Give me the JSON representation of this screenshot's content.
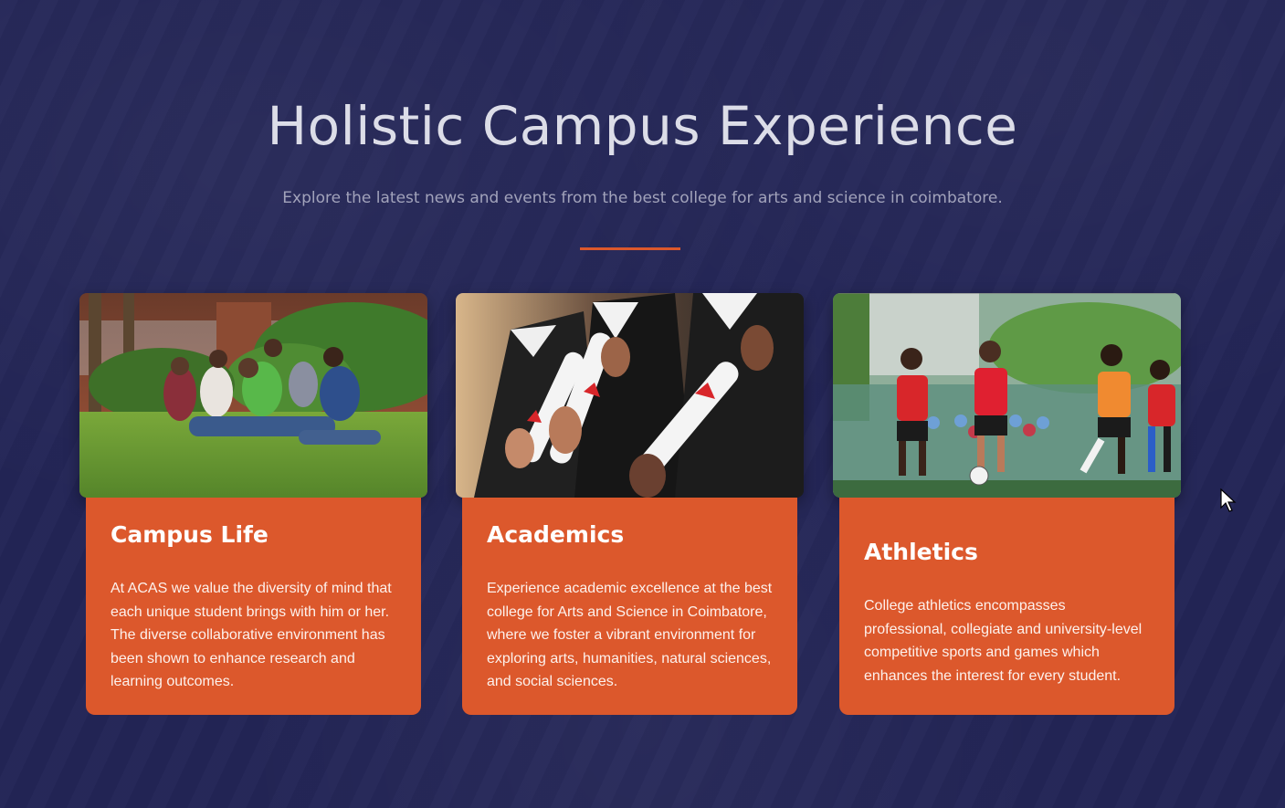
{
  "header": {
    "title": "Holistic Campus Experience",
    "subtitle": "Explore the latest news and events from the best college for arts and science in coimbatore."
  },
  "cards": [
    {
      "title": "Campus Life",
      "text": "At ACAS we value the diversity of mind that each unique student brings with him or her. The diverse collaborative environment has been shown to enhance research and learning outcomes."
    },
    {
      "title": "Academics",
      "text": "Experience academic excellence at the best college for Arts and Science in Coimbatore, where we foster a vibrant environment for exploring arts, humanities, natural sciences, and social sciences."
    },
    {
      "title": "Athletics",
      "text": "College athletics encompasses professional, collegiate and university-level competitive sports and games which enhances the interest for every student."
    }
  ],
  "colors": {
    "background": "#232556",
    "accent": "#dc582c"
  }
}
